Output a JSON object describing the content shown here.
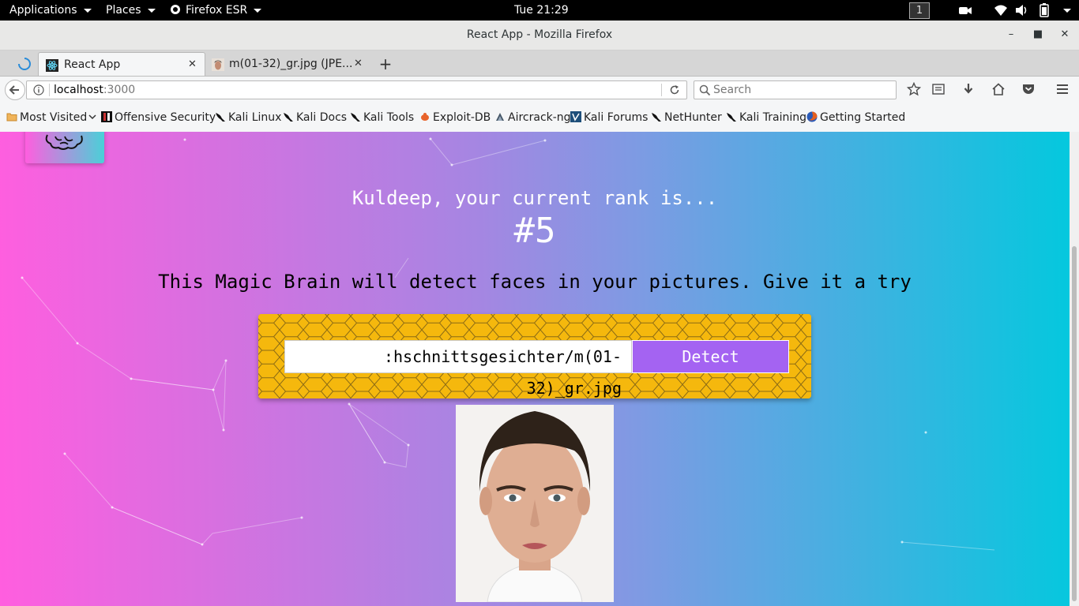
{
  "topbar": {
    "applications": "Applications",
    "places": "Places",
    "firefox": "Firefox ESR",
    "clock": "Tue 21:29",
    "workspace": "1"
  },
  "window": {
    "title": "React App - Mozilla Firefox"
  },
  "tabs": [
    {
      "label": "React App",
      "favicon": "react-icon",
      "active": true
    },
    {
      "label": "m(01-32)_gr.jpg (JPE...",
      "favicon": "photo-thumb-icon",
      "active": false
    }
  ],
  "nav": {
    "url_host": "localhost",
    "url_port": ":3000",
    "search_placeholder": "Search"
  },
  "bookmarks": {
    "most_visited": "Most Visited",
    "items": [
      "Offensive Security",
      "Kali Linux",
      "Kali Docs",
      "Kali Tools",
      "Exploit-DB",
      "Aircrack-ng",
      "Kali Forums",
      "NetHunter",
      "Kali Training",
      "Getting Started"
    ]
  },
  "page": {
    "rank_line": "Kuldeep, your current rank is...",
    "rank": "#5",
    "description": "This Magic Brain will detect faces in your pictures. Give it a try",
    "input_value": ":hschnittsgesichter/m(01-32)_gr.jpg",
    "detect_label": "Detect"
  },
  "colors": {
    "gradient_left": "#ff5edf",
    "gradient_right": "#04c8de",
    "form_bg": "#f5b80d",
    "button": "#a463f2"
  }
}
